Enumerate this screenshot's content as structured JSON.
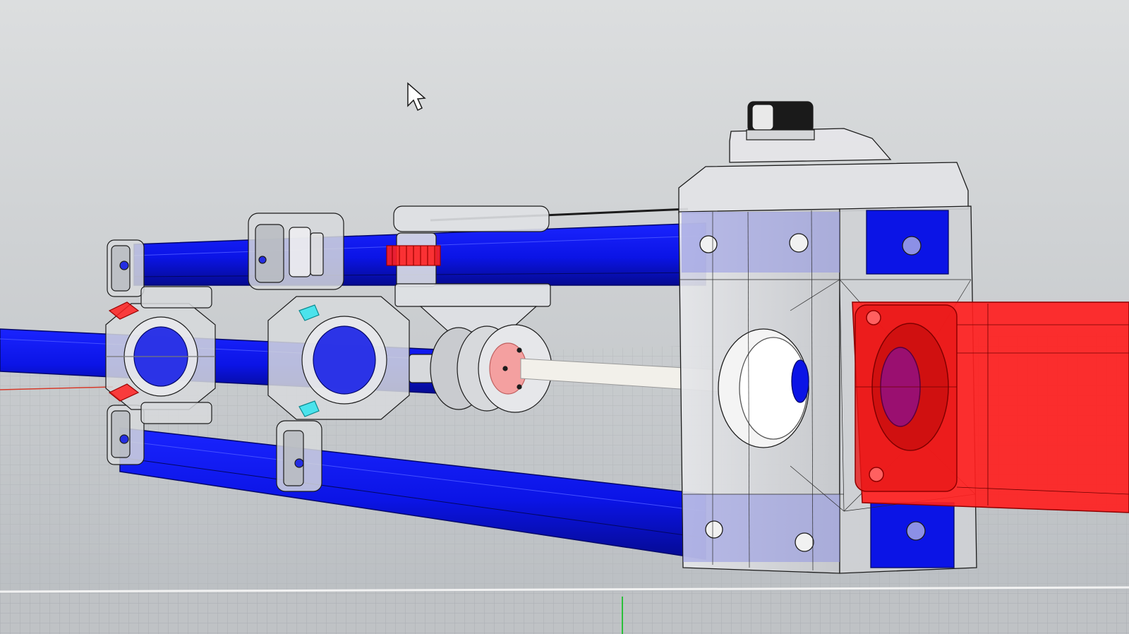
{
  "viewport": {
    "background_top": "#dcdedf",
    "background_bottom": "#b9bdc1",
    "grid_color": "#a9adb1",
    "cursor_icon": "mouse-pointer-icon"
  },
  "colors": {
    "rail_blue": "#0b14e6",
    "rail_blue_dark": "#060a9e",
    "frame_gray": "#d7d9dc",
    "wire_line": "#1c1c1c",
    "highlight_red": "#ff2020",
    "highlight_red_dark": "#c00000",
    "accent_cyan": "#33e5ee",
    "shaft_white": "#f2f0ea",
    "knob_black": "#1a1a1a",
    "axis_red": "#d63a2a",
    "axis_green": "#2bbf3a"
  },
  "model": {
    "parts": [
      "left-bearing-block",
      "middle-bearing-block",
      "carriage-bracket",
      "pulley-assembly",
      "end-housing",
      "motor-mount",
      "top-knob"
    ]
  }
}
